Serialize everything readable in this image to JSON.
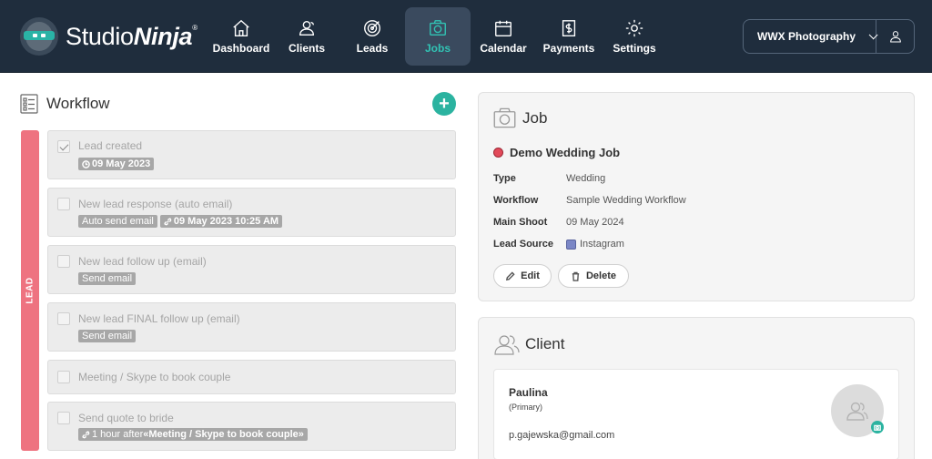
{
  "brand": {
    "name_plain": "Studio",
    "name_bold": "Ninja",
    "reg": "®"
  },
  "nav": {
    "items": [
      {
        "label": "Dashboard",
        "icon": "home-icon"
      },
      {
        "label": "Clients",
        "icon": "users-icon"
      },
      {
        "label": "Leads",
        "icon": "target-icon"
      },
      {
        "label": "Jobs",
        "icon": "camera-icon",
        "active": true
      },
      {
        "label": "Calendar",
        "icon": "calendar-icon"
      },
      {
        "label": "Payments",
        "icon": "dollar-document-icon"
      },
      {
        "label": "Settings",
        "icon": "gear-icon"
      }
    ],
    "account_name": "WWX Photography"
  },
  "workflow": {
    "title": "Workflow",
    "stage_label": "LEAD",
    "tasks": [
      {
        "title": "Lead created",
        "checked": true,
        "tags": [
          {
            "icon": "clock-icon",
            "text": "09 May 2023",
            "bold": true
          }
        ]
      },
      {
        "title": "New lead response (auto email)",
        "checked": false,
        "tags": [
          {
            "text": "Auto send email"
          },
          {
            "icon": "link-icon",
            "text": "09 May 2023 10:25 AM",
            "bold": true
          }
        ]
      },
      {
        "title": "New lead follow up (email)",
        "checked": false,
        "tags": [
          {
            "text": "Send email"
          }
        ]
      },
      {
        "title": "New lead FINAL follow up (email)",
        "checked": false,
        "tags": [
          {
            "text": "Send email"
          }
        ]
      },
      {
        "title": "Meeting / Skype to book couple",
        "checked": false,
        "tags": []
      },
      {
        "title": "Send quote to bride",
        "checked": false,
        "tags": [
          {
            "icon": "link-icon",
            "prefix": "1 hour after ",
            "text": "«Meeting / Skype to book couple»"
          }
        ]
      }
    ]
  },
  "job": {
    "section_title": "Job",
    "name": "Demo Wedding Job",
    "status_color": "#e24a5a",
    "fields": [
      {
        "label": "Type",
        "value": "Wedding"
      },
      {
        "label": "Workflow",
        "value": "Sample Wedding Workflow"
      },
      {
        "label": "Main Shoot",
        "value": "09 May 2024"
      },
      {
        "label": "Lead Source",
        "value": "Instagram",
        "chip_color": "#7b87c6"
      }
    ],
    "edit_label": "Edit",
    "delete_label": "Delete"
  },
  "client": {
    "section_title": "Client",
    "name": "Paulina",
    "role": "(Primary)",
    "email": "p.gajewska@gmail.com"
  },
  "colors": {
    "nav_bg": "#1f2d3d",
    "accent": "#2bb3a0",
    "lead_stage": "#ee7380"
  }
}
